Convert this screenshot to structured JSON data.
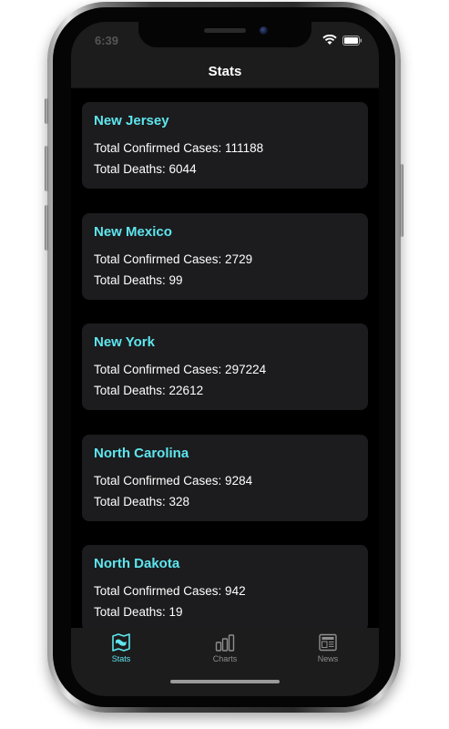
{
  "status_bar": {
    "time": "6:39"
  },
  "nav": {
    "title": "Stats"
  },
  "cases_label": "Total Confirmed Cases: ",
  "deaths_label": "Total Deaths: ",
  "cards": [
    {
      "state": "New Jersey",
      "cases_text": "Total Confirmed Cases: 111188",
      "deaths_text": "Total Deaths: 6044"
    },
    {
      "state": "New Mexico",
      "cases_text": "Total Confirmed Cases: 2729",
      "deaths_text": "Total Deaths: 99"
    },
    {
      "state": "New York",
      "cases_text": "Total Confirmed Cases: 297224",
      "deaths_text": "Total Deaths: 22612"
    },
    {
      "state": "North Carolina",
      "cases_text": "Total Confirmed Cases: 9284",
      "deaths_text": "Total Deaths: 328"
    },
    {
      "state": "North Dakota",
      "cases_text": "Total Confirmed Cases: 942",
      "deaths_text": "Total Deaths: 19"
    }
  ],
  "tabs": [
    {
      "label": "Stats",
      "icon": "map-icon",
      "active": true
    },
    {
      "label": "Charts",
      "icon": "bar-chart-icon",
      "active": false
    },
    {
      "label": "News",
      "icon": "newspaper-icon",
      "active": false
    }
  ],
  "colors": {
    "accent": "#5ee6ef",
    "card_background": "#1c1c1e",
    "screen_background": "#000000",
    "bar_background": "#1c1c1c",
    "inactive_tab": "#8e8e8e"
  }
}
